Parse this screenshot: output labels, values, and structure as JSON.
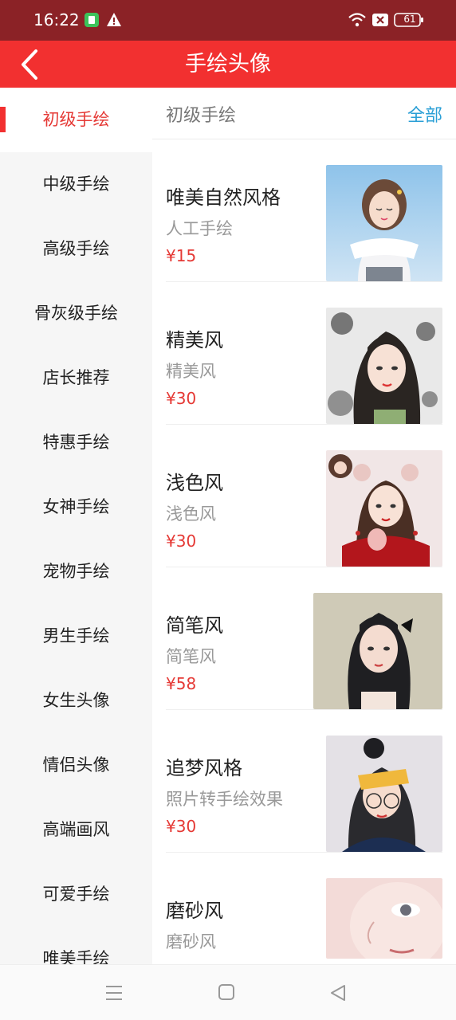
{
  "status": {
    "time": "16:22",
    "battery": "61"
  },
  "header": {
    "title": "手绘头像"
  },
  "sidebar": {
    "items": [
      {
        "label": "初级手绘",
        "active": true
      },
      {
        "label": "中级手绘"
      },
      {
        "label": "高级手绘"
      },
      {
        "label": "骨灰级手绘"
      },
      {
        "label": "店长推荐"
      },
      {
        "label": "特惠手绘"
      },
      {
        "label": "女神手绘"
      },
      {
        "label": "宠物手绘"
      },
      {
        "label": "男生手绘"
      },
      {
        "label": "女生头像"
      },
      {
        "label": "情侣头像"
      },
      {
        "label": "高端画风"
      },
      {
        "label": "可爱手绘"
      },
      {
        "label": "唯美手绘"
      }
    ]
  },
  "content": {
    "section_title": "初级手绘",
    "see_all": "全部",
    "products": [
      {
        "name": "唯美自然风格",
        "desc": "人工手绘",
        "price": "¥15"
      },
      {
        "name": "精美风",
        "desc": "精美风",
        "price": "¥30"
      },
      {
        "name": "浅色风",
        "desc": "浅色风",
        "price": "¥30"
      },
      {
        "name": "简笔风",
        "desc": "简笔风",
        "price": "¥58"
      },
      {
        "name": "追梦风格",
        "desc": "照片转手绘效果",
        "price": "¥30"
      },
      {
        "name": "磨砂风",
        "desc": "磨砂风",
        "price": ""
      }
    ]
  },
  "colors": {
    "status_bar": "#8b2226",
    "title_bar": "#f23030",
    "accent_red": "#e53935",
    "link_blue": "#2a9fd6"
  }
}
